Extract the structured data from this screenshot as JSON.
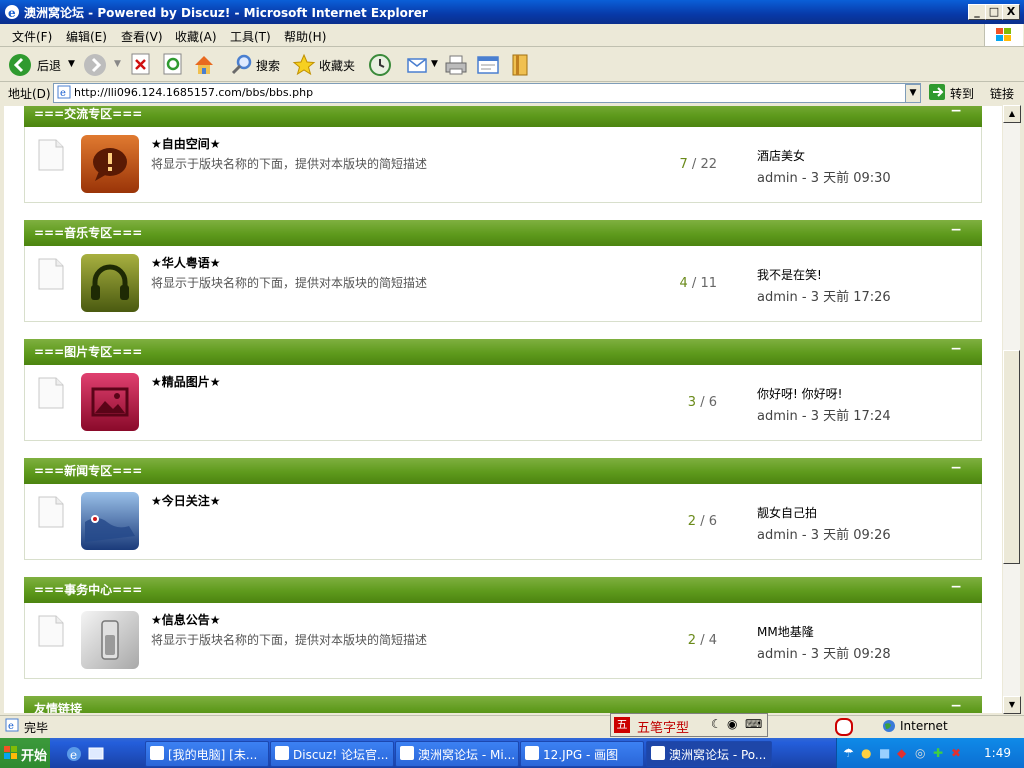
{
  "window": {
    "title": "澳洲窝论坛 - Powered by Discuz! - Microsoft Internet Explorer",
    "min": "_",
    "max": "□",
    "close": "X"
  },
  "menu": [
    "文件(F)",
    "编辑(E)",
    "查看(V)",
    "收藏(A)",
    "工具(T)",
    "帮助(H)"
  ],
  "toolbar": {
    "back": "后退",
    "search": "搜索",
    "favorites": "收藏夹"
  },
  "address": {
    "label": "地址(D)",
    "url": "http://lli096.124.1685157.com/bbs/bbs.php",
    "go": "转到",
    "links": "链接"
  },
  "sections": [
    {
      "title": "===交流专区===",
      "collapse": "−",
      "forum": {
        "name": "★自由空间★",
        "desc": "将显示于版块名称的下面，提供对本版块的简短描述",
        "topics": "7",
        "posts": "22",
        "last_title": "酒店美女",
        "last_by": "admin - 3 天前 09:30"
      }
    },
    {
      "title": "===音乐专区===",
      "collapse": "−",
      "forum": {
        "name": "★华人粤语★",
        "desc": "将显示于版块名称的下面，提供对本版块的简短描述",
        "topics": "4",
        "posts": "11",
        "last_title": "我不是在笑!",
        "last_by": "admin - 3 天前 17:26"
      }
    },
    {
      "title": "===图片专区===",
      "collapse": "−",
      "forum": {
        "name": "★精品图片★",
        "desc": "",
        "topics": "3",
        "posts": "6",
        "last_title": "你好呀! 你好呀!",
        "last_by": "admin - 3 天前 17:24"
      }
    },
    {
      "title": "===新闻专区===",
      "collapse": "−",
      "forum": {
        "name": "★今日关注★",
        "desc": "",
        "topics": "2",
        "posts": "6",
        "last_title": "靓女自己拍",
        "last_by": "admin - 3 天前 09:26"
      }
    },
    {
      "title": "===事务中心===",
      "collapse": "−",
      "forum": {
        "name": "★信息公告★",
        "desc": "将显示于版块名称的下面，提供对本版块的简短描述",
        "topics": "2",
        "posts": "4",
        "last_title": "MM地基隆",
        "last_by": "admin - 3 天前 09:28"
      }
    }
  ],
  "links_section": {
    "title": "友情链接",
    "collapse": "−"
  },
  "status": {
    "text": "完毕",
    "ime": "五笔字型",
    "zone": "Internet"
  },
  "taskbar": {
    "start": "开始",
    "tasks": [
      "[我的电脑] [未...",
      "Discuz! 论坛官...",
      "澳洲窝论坛 - Mi...",
      "12.JPG - 画图",
      "澳洲窝论坛 - Po..."
    ],
    "clock": "1:49"
  }
}
